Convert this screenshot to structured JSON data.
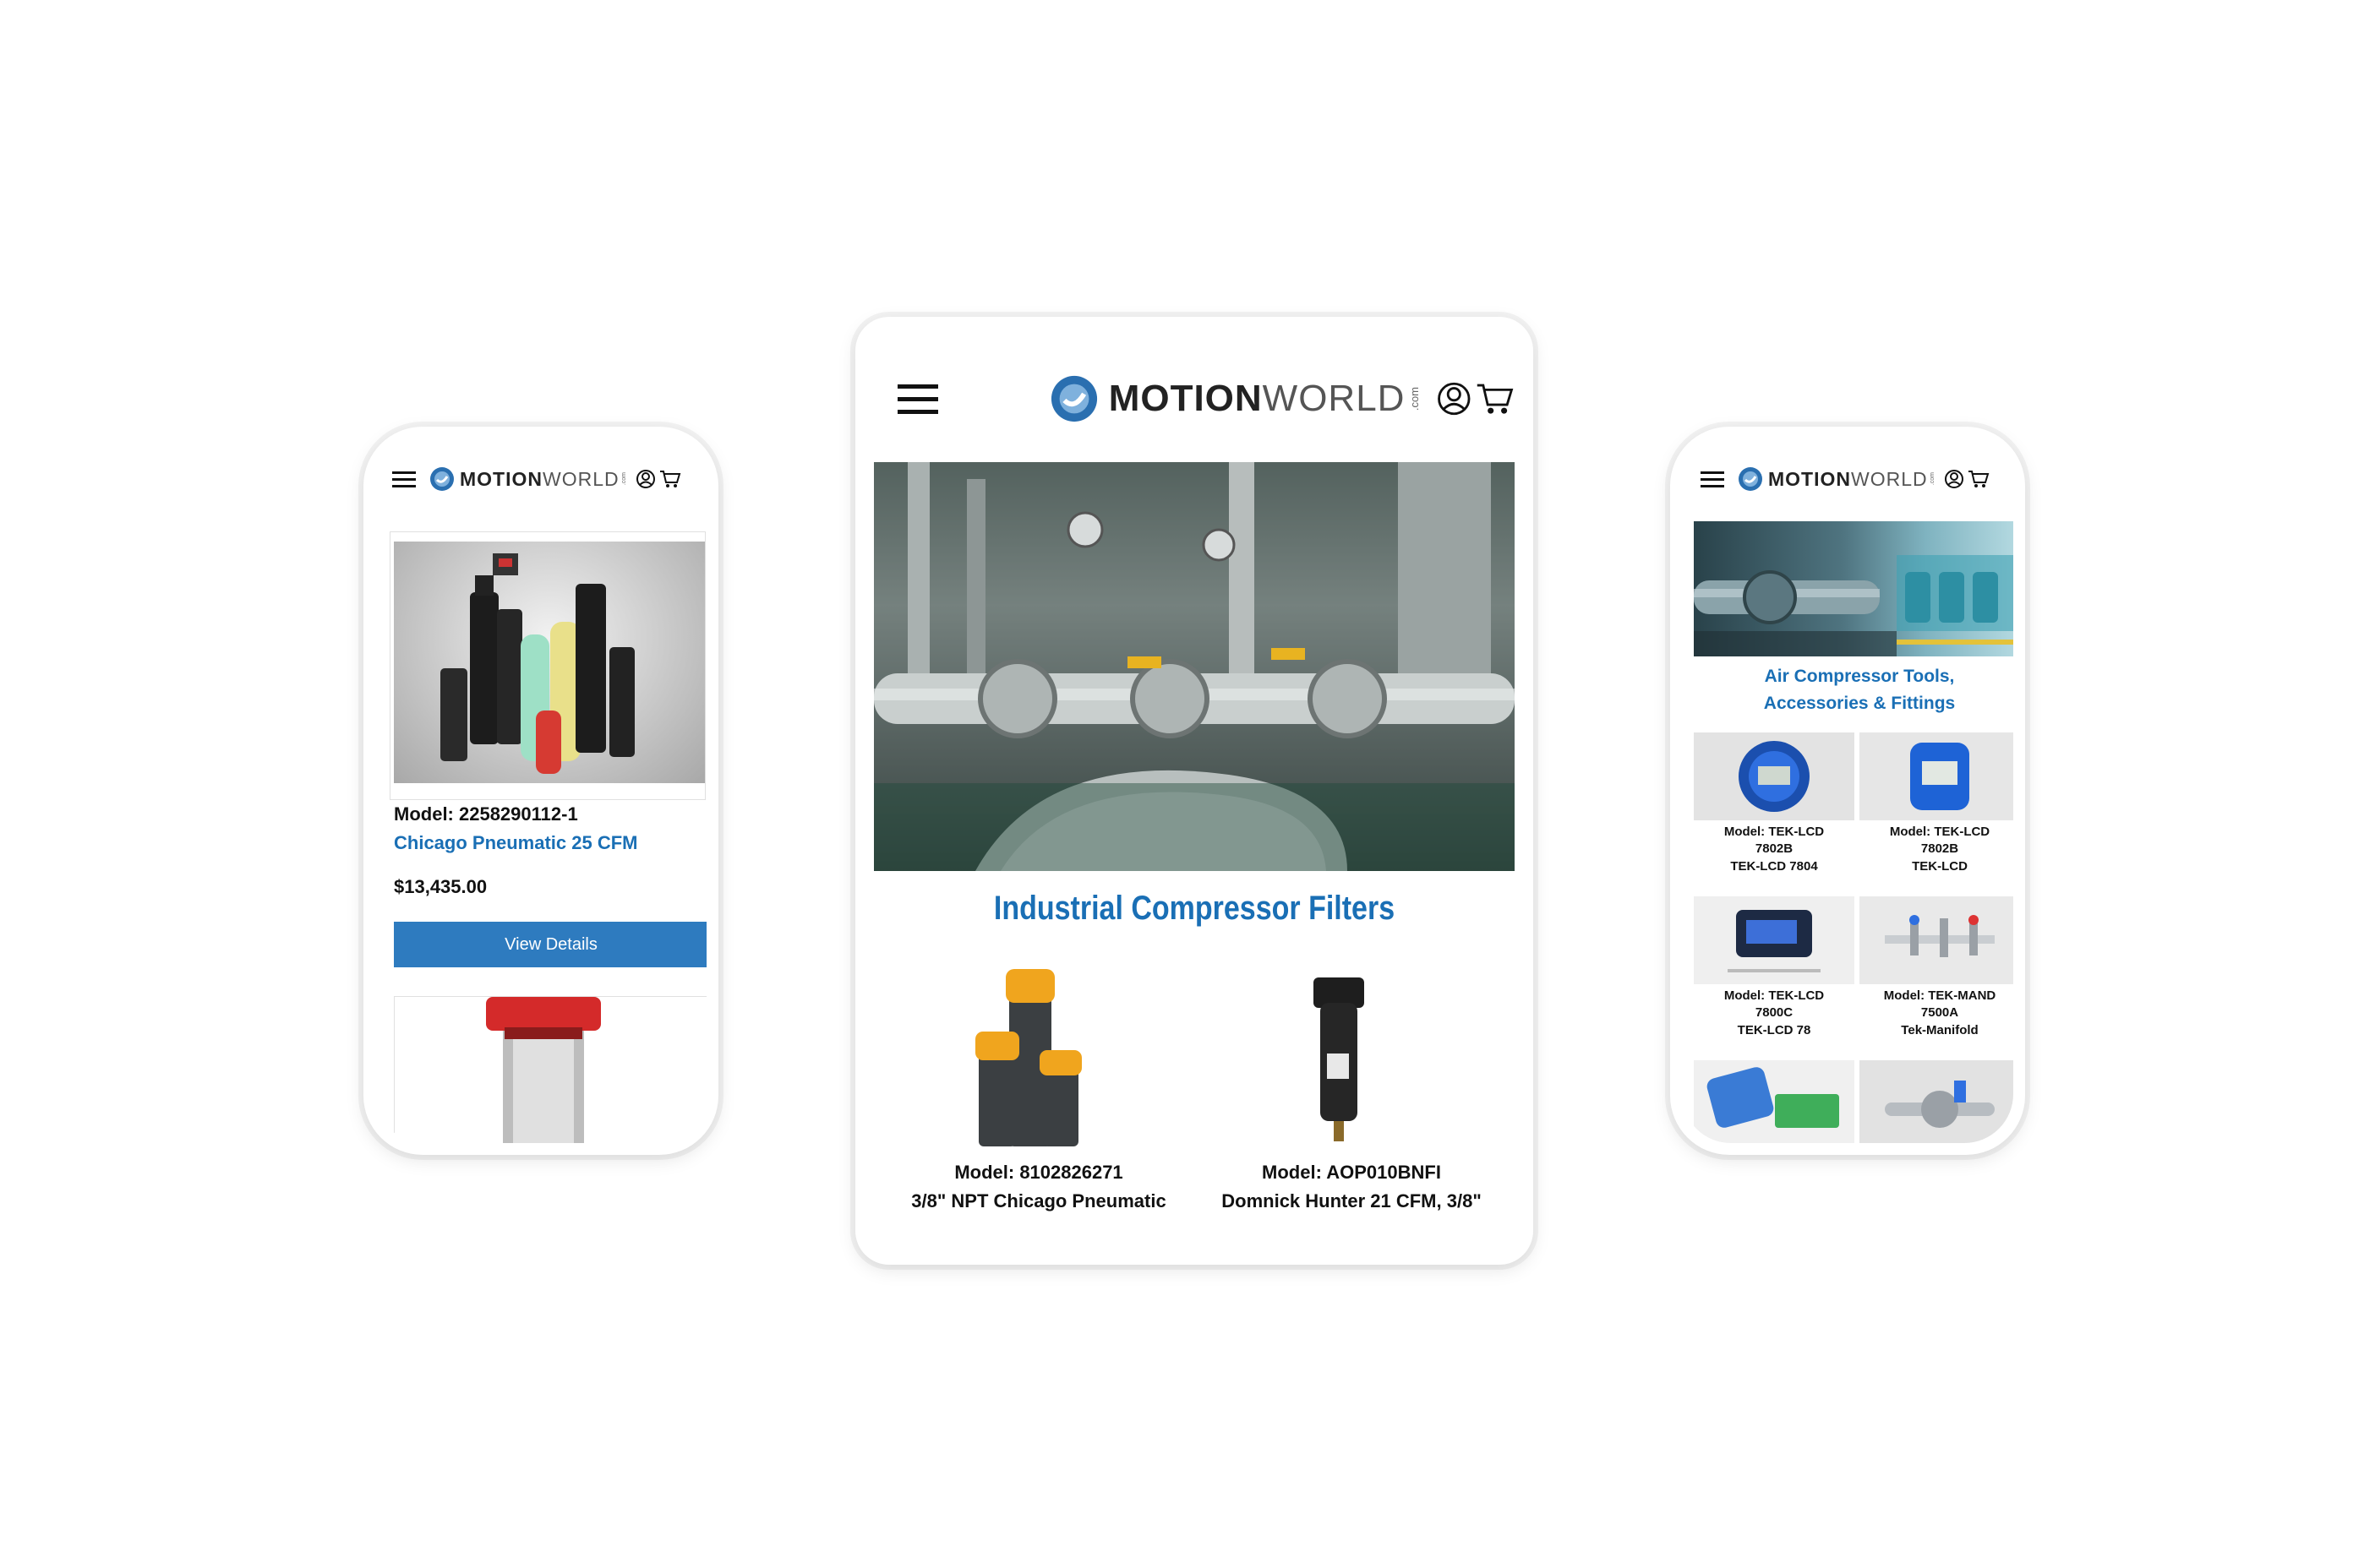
{
  "brand": {
    "name_bold": "MOTION",
    "name_light": "WORLD",
    "suffix": ".com"
  },
  "colors": {
    "accent": "#1a6fb5",
    "button": "#2e7bbf",
    "text": "#111111"
  },
  "icons": [
    "menu-icon",
    "user-icon",
    "cart-icon"
  ],
  "left_phone": {
    "product": {
      "model": "Model: 2258290112-1",
      "name": "Chicago Pneumatic 25 CFM",
      "price": "$13,435.00",
      "button": "View Details"
    }
  },
  "tablet": {
    "heading": "Industrial Compressor Filters",
    "products": [
      {
        "model": "Model: 8102826271",
        "name": "3/8\" NPT Chicago Pneumatic"
      },
      {
        "model": "Model: AOP010BNFI",
        "name": "Domnick Hunter 21 CFM, 3/8\""
      }
    ]
  },
  "right_phone": {
    "heading_line1": "Air Compressor Tools,",
    "heading_line2": "Accessories & Fittings",
    "tiles": [
      {
        "l1": "Model: TEK-LCD",
        "l2": "7802B",
        "l3": "TEK-LCD 7804"
      },
      {
        "l1": "Model: TEK-LCD",
        "l2": "7802B",
        "l3": "TEK-LCD"
      },
      {
        "l1": "Model: TEK-LCD",
        "l2": "7800C",
        "l3": "TEK-LCD 78"
      },
      {
        "l1": "Model: TEK-MAND",
        "l2": "7500A",
        "l3": "Tek-Manifold"
      }
    ]
  }
}
